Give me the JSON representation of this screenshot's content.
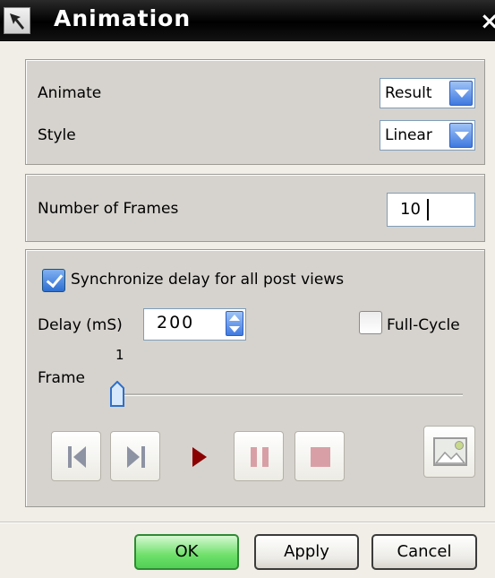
{
  "window": {
    "title": "Animation",
    "close_glyph": "×"
  },
  "group_animate": {
    "animate_label": "Animate",
    "animate_value": "Result",
    "style_label": "Style",
    "style_value": "Linear"
  },
  "group_frames": {
    "frames_label": "Number of Frames",
    "frames_value": "10"
  },
  "group_playback": {
    "sync_label": "Synchronize delay for all post views",
    "sync_checked": true,
    "delay_label": "Delay (mS)",
    "delay_value": "200",
    "fullcycle_label": "Full-Cycle",
    "fullcycle_checked": false,
    "frame_label": "Frame",
    "frame_value": "1",
    "media_buttons": [
      "step-back-icon",
      "step-forward-icon",
      "play-icon",
      "pause-icon",
      "stop-icon",
      "export-image-icon"
    ]
  },
  "footer": {
    "ok": "OK",
    "apply": "Apply",
    "cancel": "Cancel"
  },
  "colors": {
    "accent": "#3f7ae0",
    "ok_green": "#52cf55",
    "play_red": "#8b0000",
    "panel": "#d6d3ce"
  }
}
